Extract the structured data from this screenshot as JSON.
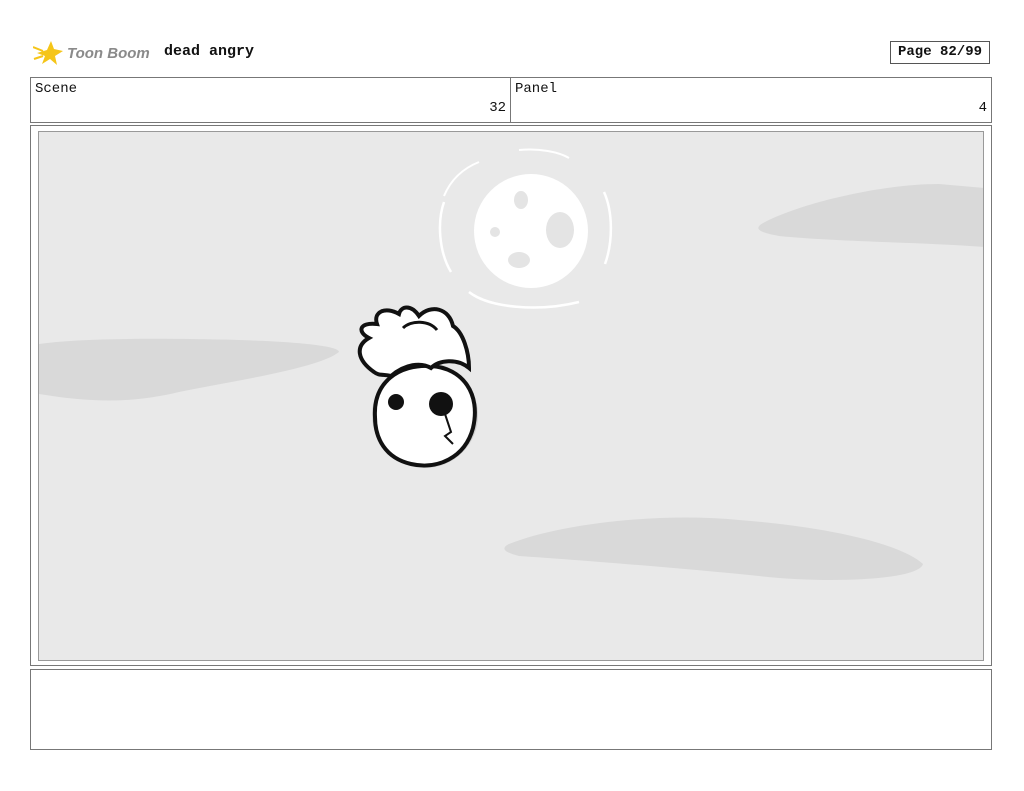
{
  "header": {
    "logo_text": "Toon Boom",
    "project_title": "dead angry",
    "page_label": "Page 82/99"
  },
  "info": {
    "scene_label": "Scene",
    "scene_value": "32",
    "panel_label": "Panel",
    "panel_value": "4"
  },
  "notes": {
    "text": ""
  },
  "colors": {
    "logo_star": "#f5c518",
    "logo_text": "#8a8a8a",
    "background": "#e9e9e9",
    "cloud": "#d9d9d9"
  }
}
